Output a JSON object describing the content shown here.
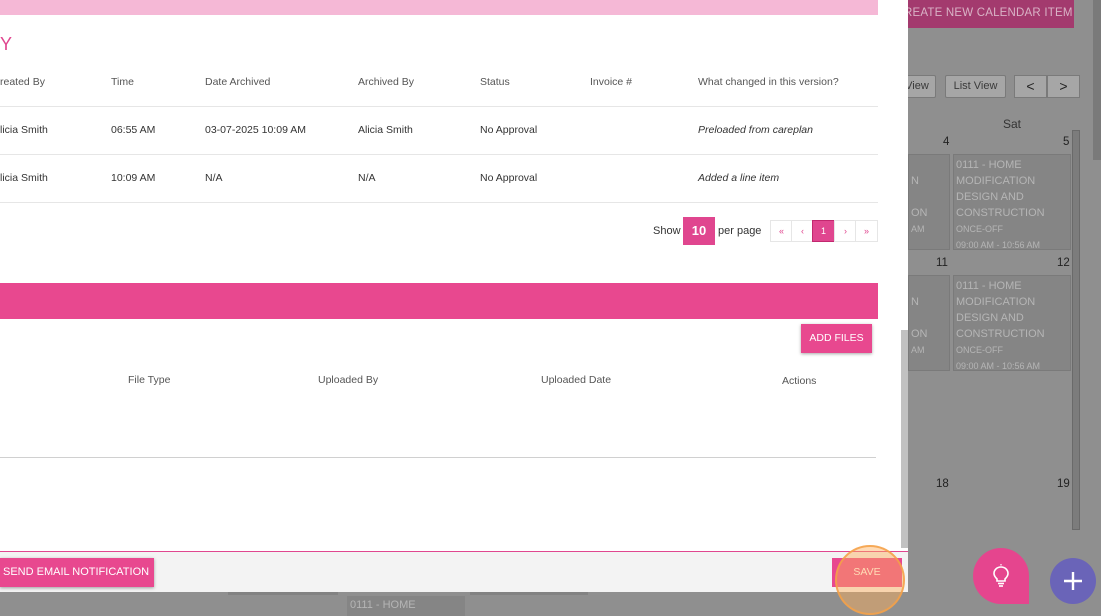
{
  "background": {
    "create_button": "REATE NEW CALENDAR ITEM",
    "view_buttons": [
      "View",
      "List View"
    ],
    "nav_arrows": [
      "<",
      ">"
    ],
    "day_header": "Sat",
    "day_numbers": {
      "r1a": "4",
      "r1b": "5",
      "r2a": "11",
      "r2b": "12",
      "r3a": "18",
      "r3b": "19"
    },
    "events": [
      {
        "title_lines": [
          "0111 - HOME",
          "MODIFICATION",
          "DESIGN AND",
          "CONSTRUCTION"
        ],
        "type": "ONCE-OFF",
        "time": "09:00 AM - 10:56 AM"
      },
      {
        "title_lines": [
          "0111 - HOME",
          "MODIFICATION",
          "DESIGN AND",
          "CONSTRUCTION"
        ],
        "type": "ONCE-OFF",
        "time": "09:00 AM - 10:56 AM"
      }
    ],
    "partial_events": [
      {
        "lines": [
          "N",
          "",
          "ON",
          "AM"
        ]
      },
      {
        "lines": [
          "N",
          "",
          "ON",
          "AM"
        ]
      }
    ],
    "bottom_event": "0111 - HOME"
  },
  "history": {
    "title": "Y",
    "headers": [
      "reated By",
      "Time",
      "Date Archived",
      "Archived By",
      "Status",
      "Invoice #",
      "What changed in this version?"
    ],
    "rows": [
      [
        "licia Smith",
        "06:55 AM",
        "03-07-2025 10:09 AM",
        "Alicia Smith",
        "No Approval",
        "",
        "Preloaded from careplan"
      ],
      [
        "licia Smith",
        "10:09 AM",
        "N/A",
        "N/A",
        "No Approval",
        "",
        "Added a line item"
      ]
    ],
    "pagination": {
      "show_label": "Show",
      "per_page_value": "10",
      "per_page_label": "per page",
      "first": "«",
      "prev": "‹",
      "current": "1",
      "next": "›",
      "last": "»"
    }
  },
  "files": {
    "add_button": "ADD FILES",
    "headers": [
      "File Type",
      "Uploaded By",
      "Uploaded Date",
      "Actions"
    ]
  },
  "footer": {
    "send_email": "SEND EMAIL NOTIFICATION",
    "save": "SAVE"
  },
  "colors": {
    "accent": "#e8488f",
    "accent_light": "#f5b8d6",
    "fab_purple": "#6a64b8"
  },
  "icons": {
    "fab_left": "lightbulb-icon",
    "fab_right": "plus-icon"
  }
}
